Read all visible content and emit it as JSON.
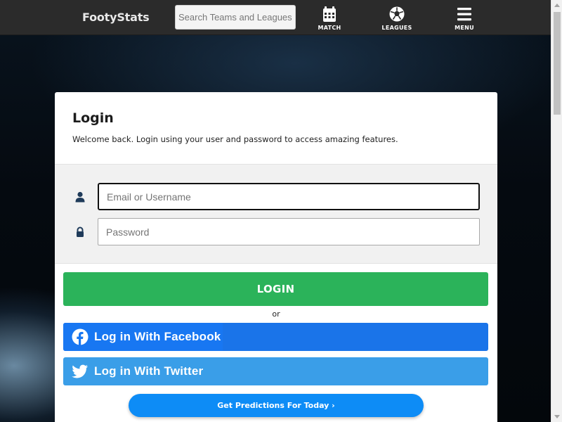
{
  "header": {
    "logo": "FootyStats",
    "search_placeholder": "Search Teams and Leagues",
    "nav": [
      {
        "label": "MATCH",
        "icon": "calendar-icon"
      },
      {
        "label": "LEAGUES",
        "icon": "soccer-ball-icon"
      },
      {
        "label": "MENU",
        "icon": "hamburger-menu-icon"
      }
    ]
  },
  "login": {
    "title": "Login",
    "subtitle": "Welcome back. Login using your user and password to access amazing features.",
    "username_placeholder": "Email or Username",
    "password_placeholder": "Password",
    "username_icon": "user-icon",
    "password_icon": "lock-icon",
    "login_button": "LOGIN",
    "or_text": "or",
    "facebook_button": "Log in With Facebook",
    "twitter_button": "Log in With Twitter",
    "predictions_button": "Get Predictions For Today ›"
  },
  "colors": {
    "header_bg": "#2b2b2b",
    "login_green": "#2bb35a",
    "facebook_blue": "#1877f2",
    "twitter_blue": "#3a9ee8",
    "predictions_blue": "#0d8cf6"
  }
}
